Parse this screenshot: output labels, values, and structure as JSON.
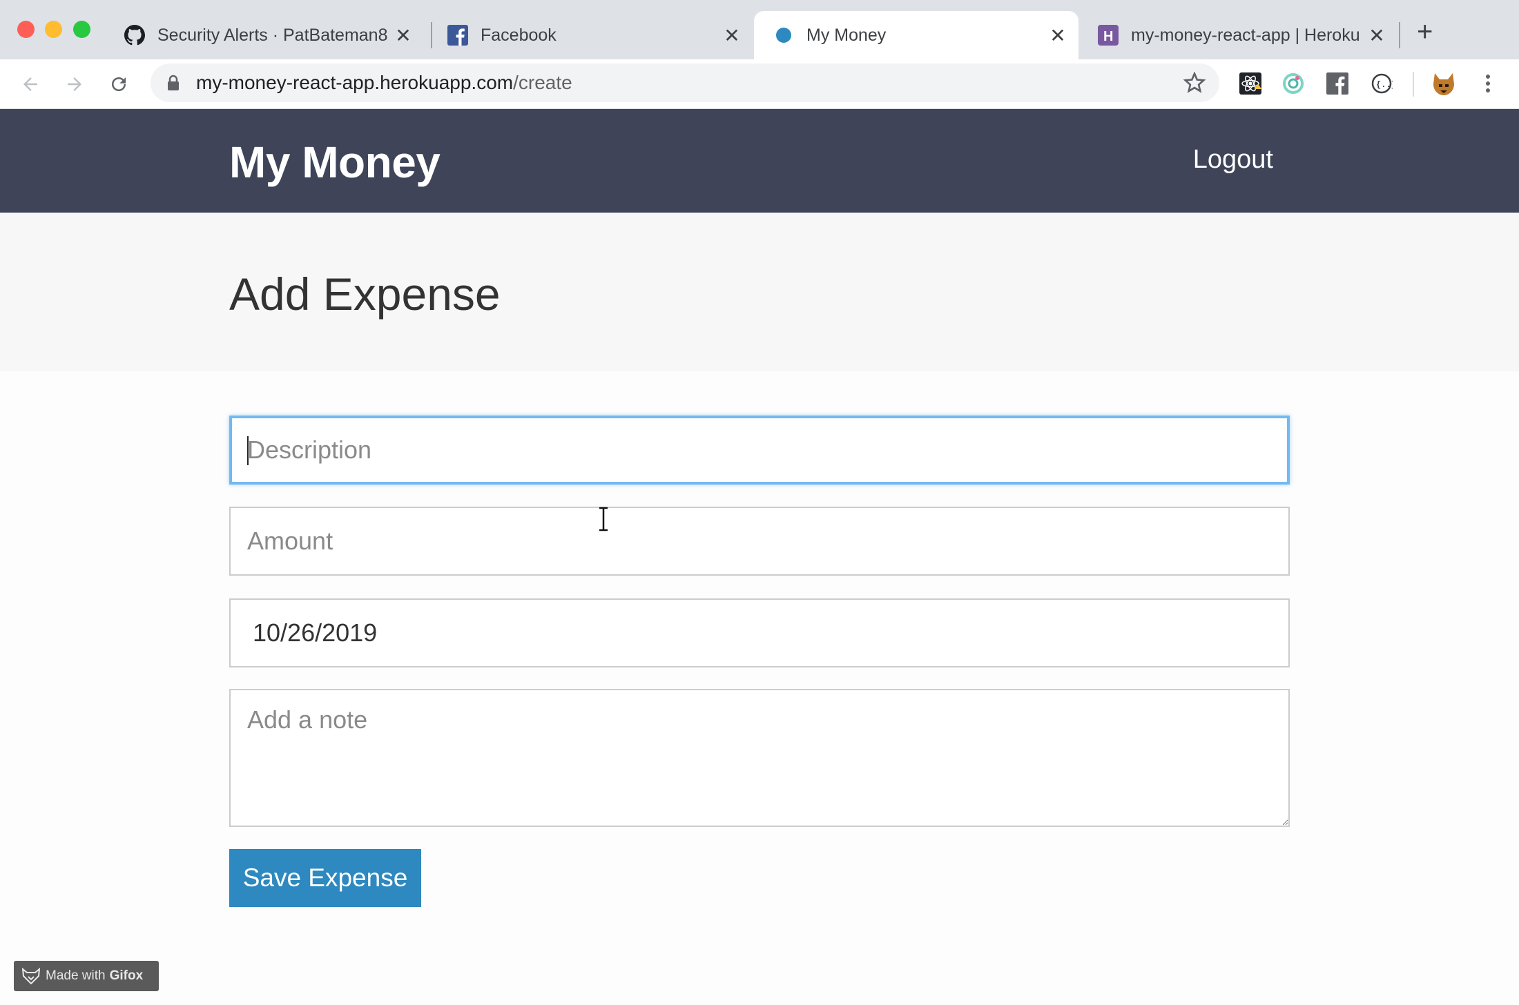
{
  "browser": {
    "tabs": [
      {
        "title": "Security Alerts · PatBateman8",
        "favicon": "github-icon"
      },
      {
        "title": "Facebook",
        "favicon": "facebook-icon"
      },
      {
        "title": "My Money",
        "favicon": "blue-dot-icon",
        "active": true
      },
      {
        "title": "my-money-react-app | Heroku",
        "favicon": "heroku-icon"
      }
    ],
    "url_host": "my-money-react-app.herokuapp.com",
    "url_path": "/create",
    "extensions": [
      "react-devtools-icon",
      "extension-ring-icon",
      "facebook-ext-icon",
      "json-viewer-icon",
      "profile-avatar"
    ]
  },
  "app": {
    "title": "My Money",
    "logout_label": "Logout"
  },
  "page": {
    "title": "Add Expense"
  },
  "form": {
    "description_placeholder": "Description",
    "amount_placeholder": "Amount",
    "date_value": "10/26/2019",
    "note_placeholder": "Add a note",
    "save_label": "Save Expense"
  },
  "watermark": {
    "prefix": "Made with",
    "brand": "Gifox"
  },
  "colors": {
    "header_bg": "#3f4459",
    "button_bg": "#2d89bf",
    "focus_border": "#74b8f0"
  }
}
